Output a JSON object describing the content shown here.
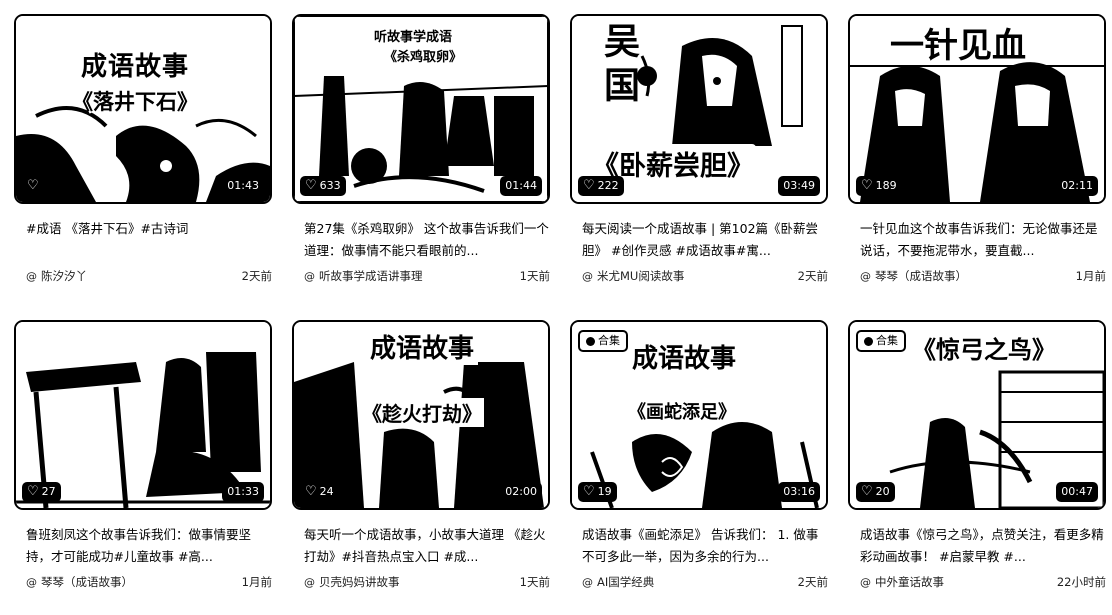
{
  "cards": [
    {
      "overlay_title": "成语故事",
      "overlay_sub": "《落井下石》",
      "collection": "",
      "likes": "",
      "duration": "01:43",
      "title": "#成语 《落井下石》#古诗词",
      "author": "陈汐汐丫",
      "time": "2天前"
    },
    {
      "overlay_title": "听故事学成语",
      "overlay_sub": "《杀鸡取卵》",
      "collection": "",
      "likes": "633",
      "duration": "01:44",
      "title": "第27集《杀鸡取卵》 这个故事告诉我们一个道理：做事情不能只看眼前的...",
      "author": "听故事学成语讲事理",
      "time": "1天前"
    },
    {
      "overlay_title": "吴国",
      "overlay_sub": "《卧薪尝胆》",
      "collection": "",
      "likes": "222",
      "duration": "03:49",
      "title": "每天阅读一个成语故事 | 第102篇《卧薪尝胆》 #创作灵感 #成语故事#寓...",
      "author": "米尤MU阅读故事",
      "time": "2天前"
    },
    {
      "overlay_title": "一针见血",
      "overlay_sub": "",
      "collection": "",
      "likes": "189",
      "duration": "02:11",
      "title": "一针见血这个故事告诉我们：无论做事还是说话，不要拖泥带水，要直截...",
      "author": "琴琴（成语故事）",
      "time": "1月前"
    },
    {
      "overlay_title": "",
      "overlay_sub": "",
      "collection": "",
      "likes": "27",
      "duration": "01:33",
      "title": "鲁班刻凤这个故事告诉我们：做事情要坚持，才可能成功#儿童故事 #高...",
      "author": "琴琴（成语故事）",
      "time": "1月前"
    },
    {
      "overlay_title": "成语故事",
      "overlay_sub": "《趁火打劫》",
      "collection": "",
      "likes": "24",
      "duration": "02:00",
      "title": "每天听一个成语故事，小故事大道理 《趁火打劫》#抖音热点宝入口 #成...",
      "author": "贝壳妈妈讲故事",
      "time": "1天前"
    },
    {
      "overlay_title": "成语故事",
      "overlay_sub": "《画蛇添足》",
      "collection": "合集",
      "likes": "19",
      "duration": "03:16",
      "title": "成语故事《画蛇添足》 告诉我们： 1. 做事不可多此一举，因为多余的行为...",
      "author": "AI国学经典",
      "time": "2天前"
    },
    {
      "overlay_title": "《惊弓之鸟》",
      "overlay_sub": "",
      "collection": "合集",
      "likes": "20",
      "duration": "00:47",
      "title": "成语故事《惊弓之鸟》，点赞关注，看更多精彩动画故事！ #启蒙早教 #...",
      "author": "中外童话故事",
      "time": "22小时前"
    }
  ]
}
